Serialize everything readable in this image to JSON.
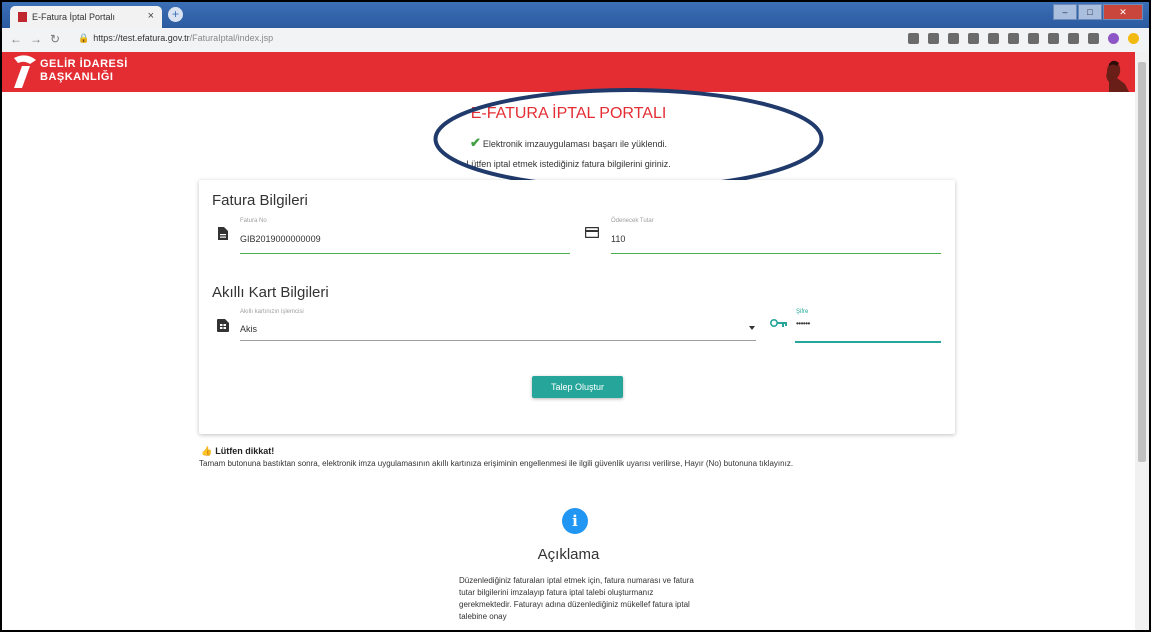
{
  "browser": {
    "tab_title": "E-Fatura İptal Portalı",
    "tab_close": "×",
    "new_tab": "+",
    "url_host": "https://test.efatura.gov.tr",
    "url_path": "/FaturaIptal/index.jsp",
    "window_controls": [
      "–",
      "□",
      "✕"
    ]
  },
  "header": {
    "logo_line1": "GELİR İDARESİ",
    "logo_line2": "BAŞKANLIĞI"
  },
  "portal": {
    "title": "E-FATURA İPTAL PORTALI",
    "success_message": "Elektronik imzauygulaması başarı ile yüklendi.",
    "instruction": "Lütfen iptal etmek istediğiniz fatura bilgilerini giriniz."
  },
  "invoice": {
    "section_title": "Fatura Bilgileri",
    "invoice_no_label": "Fatura No",
    "invoice_no_value": "GIB2019000000009",
    "amount_label": "Ödenecek Tutar",
    "amount_value": "110"
  },
  "smartcard": {
    "section_title": "Akıllı Kart Bilgileri",
    "processor_label": "Akıllı kartınızın işlemcisi",
    "processor_value": "Akis",
    "password_label": "Şifre",
    "password_value": "••••••"
  },
  "actions": {
    "submit_label": "Talep Oluştur"
  },
  "notice": {
    "title": "Lütfen dikkat!",
    "text": "Tamam butonuna bastıktan sonra, elektronik imza uygulamasının akıllı kartınıza erişiminin engellenmesi ile ilgili güvenlik uyarısı verilirse, Hayır (No) butonuna tıklayınız."
  },
  "description": {
    "icon_glyph": "i",
    "title": "Açıklama",
    "body": "Düzenlediğiniz faturaları iptal etmek için, fatura numarası ve fatura tutar bilgilerini imzalayıp fatura iptal talebi oluşturmanız gerekmektedir. Faturayı adına düzenlediğiniz mükellef fatura iptal talebine onay"
  },
  "colors": {
    "brand_red": "#e32d33",
    "accent_green": "#4caf50",
    "accent_teal": "#26a69a",
    "info_blue": "#2196f3",
    "annotation_navy": "#1f3a6b"
  },
  "icons": [
    "document-icon",
    "credit-card-icon",
    "sim-card-icon",
    "key-icon",
    "check-icon",
    "info-icon",
    "thumbs-up-icon",
    "dropdown-arrow-icon"
  ]
}
